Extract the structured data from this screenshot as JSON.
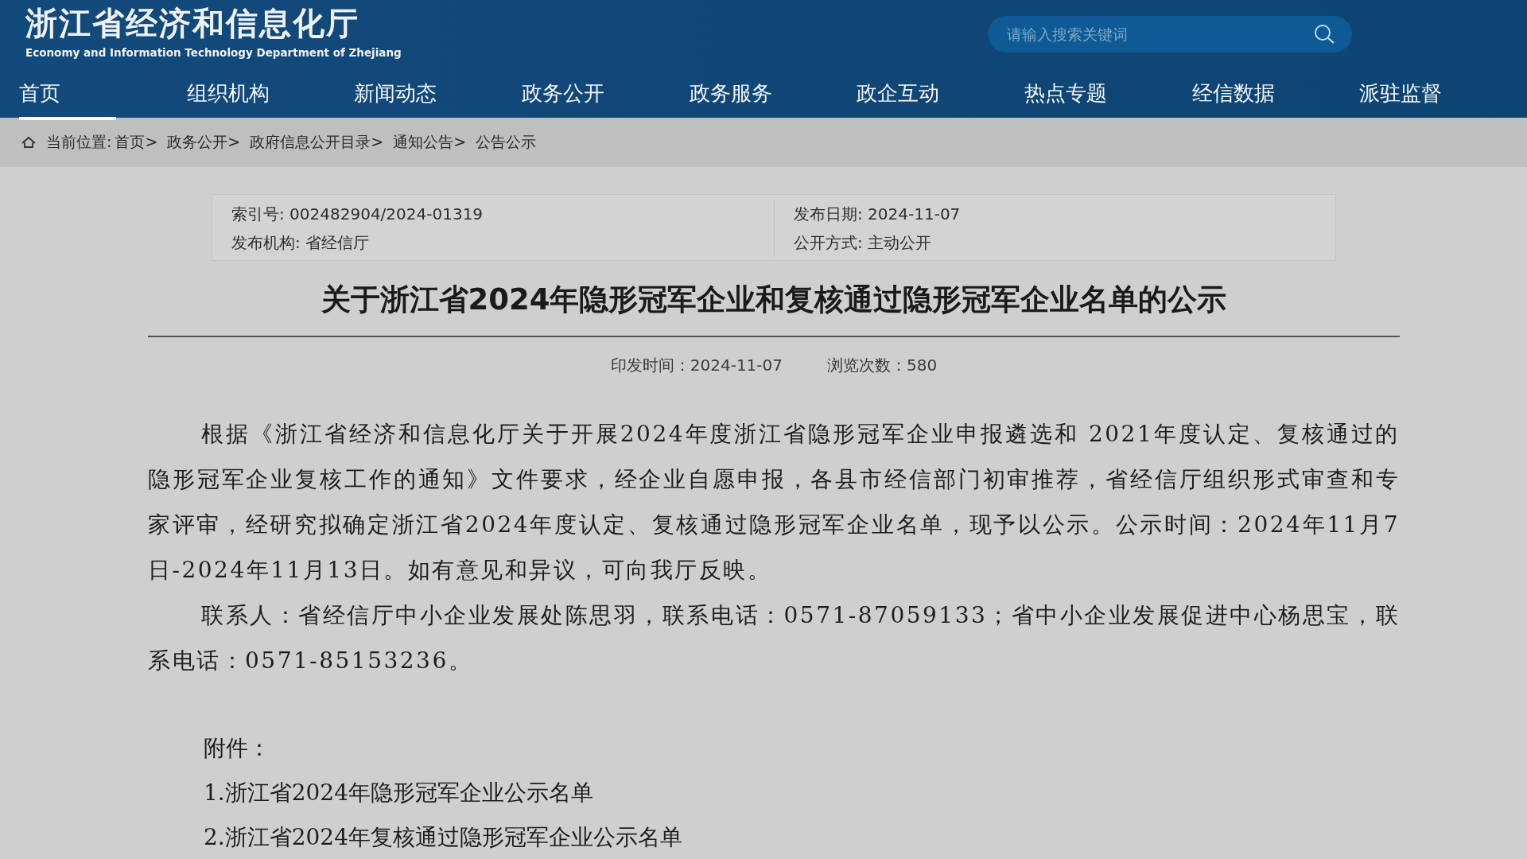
{
  "header": {
    "title": "浙江省经济和信息化厅",
    "subtitle": "Economy and Information Technology Department of Zhejiang"
  },
  "search": {
    "placeholder": "请输入搜索关键词"
  },
  "nav": [
    {
      "label": "首页",
      "selected": true
    },
    {
      "label": "组织机构",
      "selected": false
    },
    {
      "label": "新闻动态",
      "selected": false
    },
    {
      "label": "政务公开",
      "selected": false
    },
    {
      "label": "政务服务",
      "selected": false
    },
    {
      "label": "政企互动",
      "selected": false
    },
    {
      "label": "热点专题",
      "selected": false
    },
    {
      "label": "经信数据",
      "selected": false
    },
    {
      "label": "派驻监督",
      "selected": false
    }
  ],
  "breadcrumb": {
    "label": "当前位置:",
    "items": [
      "首页>",
      "政务公开>",
      "政府信息公开目录>",
      "通知公告>",
      "公告公示"
    ]
  },
  "meta": [
    "索引号: 002482904/2024-01319",
    "发布日期: 2024-11-07",
    "发布机构: 省经信厅",
    "公开方式: 主动公开"
  ],
  "article": {
    "title": "关于浙江省2024年隐形冠军企业和复核通过隐形冠军企业名单的公示",
    "info": [
      "印发时间：2024-11-07",
      "浏览次数：580"
    ],
    "paragraphs": [
      "根据《浙江省经济和信息化厅关于开展2024年度浙江省隐形冠军企业申报遴选和 2021年度认定、复核通过的隐形冠军企业复核工作的通知》文件要求，经企业自愿申报，各县市经信部门初审推荐，省经信厅组织形式审查和专家评审，经研究拟确定浙江省2024年度认定、复核通过隐形冠军企业名单，现予以公示。公示时间：2024年11月7日-2024年11月13日。如有意见和异议，可向我厅反映。",
      "联系人：省经信厅中小企业发展处陈思羽，联系电话：0571-87059133；省中小企业发展促进中心杨思宝，联系电话：0571-85153236。"
    ],
    "attachments_label": "附件：",
    "attachments": [
      "1.浙江省2024年隐形冠军企业公示名单",
      "2.浙江省2024年复核通过隐形冠军企业公示名单"
    ]
  }
}
